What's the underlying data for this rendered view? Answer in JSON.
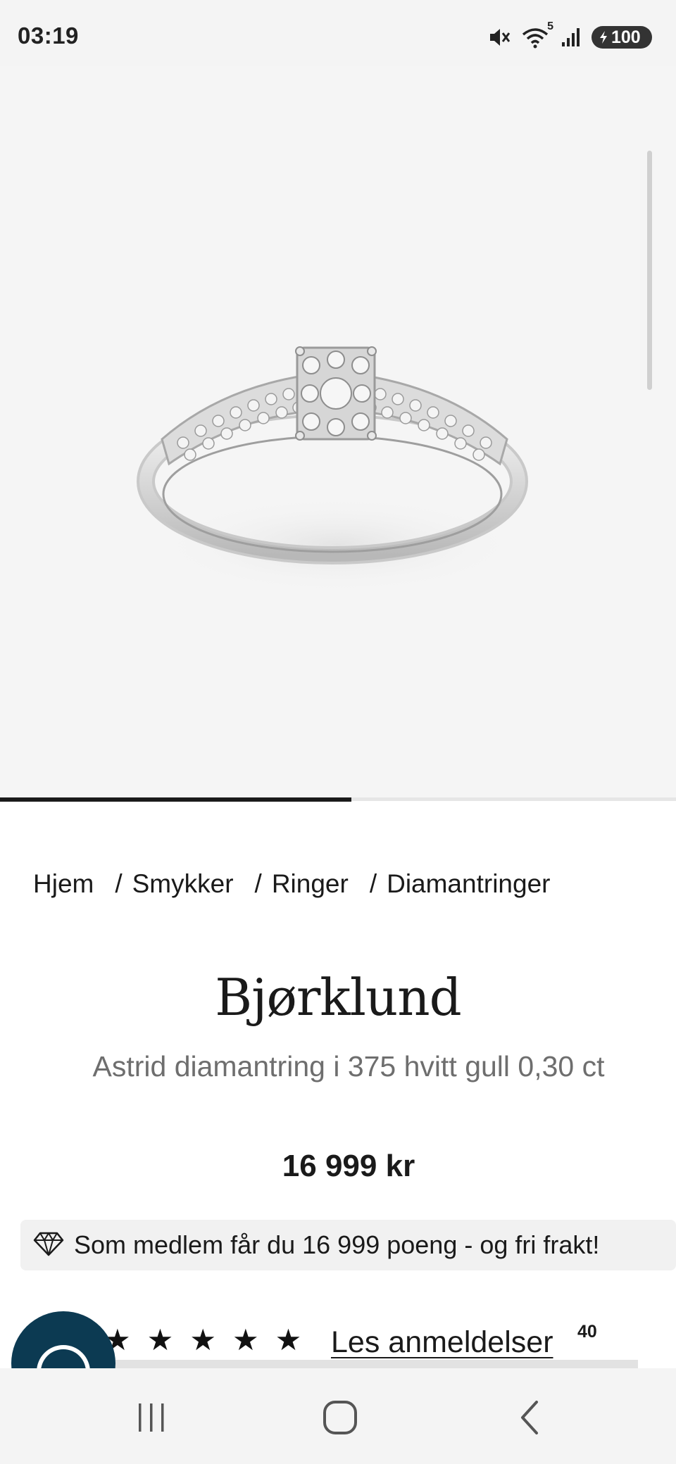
{
  "status_bar": {
    "time": "03:19",
    "icons": [
      "mute-icon",
      "wifi-icon",
      "signal-icon"
    ],
    "wifi_badge": "5",
    "battery": "100"
  },
  "carousel": {
    "progress": 0.52
  },
  "breadcrumb": {
    "items": [
      "Hjem",
      "Smykker",
      "Ringer",
      "Diamantringer"
    ],
    "separator": "/"
  },
  "product": {
    "brand": "Bjørklund",
    "title": "Astrid diamantring i 375 hvitt gull 0,30 ct",
    "price": "16 999 kr"
  },
  "member_banner": {
    "text": "Som medlem får du 16 999 poeng - og fri frakt!"
  },
  "reviews": {
    "stars": [
      "★",
      "★",
      "★",
      "★",
      "★"
    ],
    "rating": 5,
    "link_label": "Les anmeldelser",
    "count": "40"
  },
  "colors": {
    "accent_fab": "#0c3a52",
    "text": "#1a1a1a",
    "muted": "#6e6e6e"
  },
  "nav": [
    "recent-apps",
    "home",
    "back"
  ]
}
